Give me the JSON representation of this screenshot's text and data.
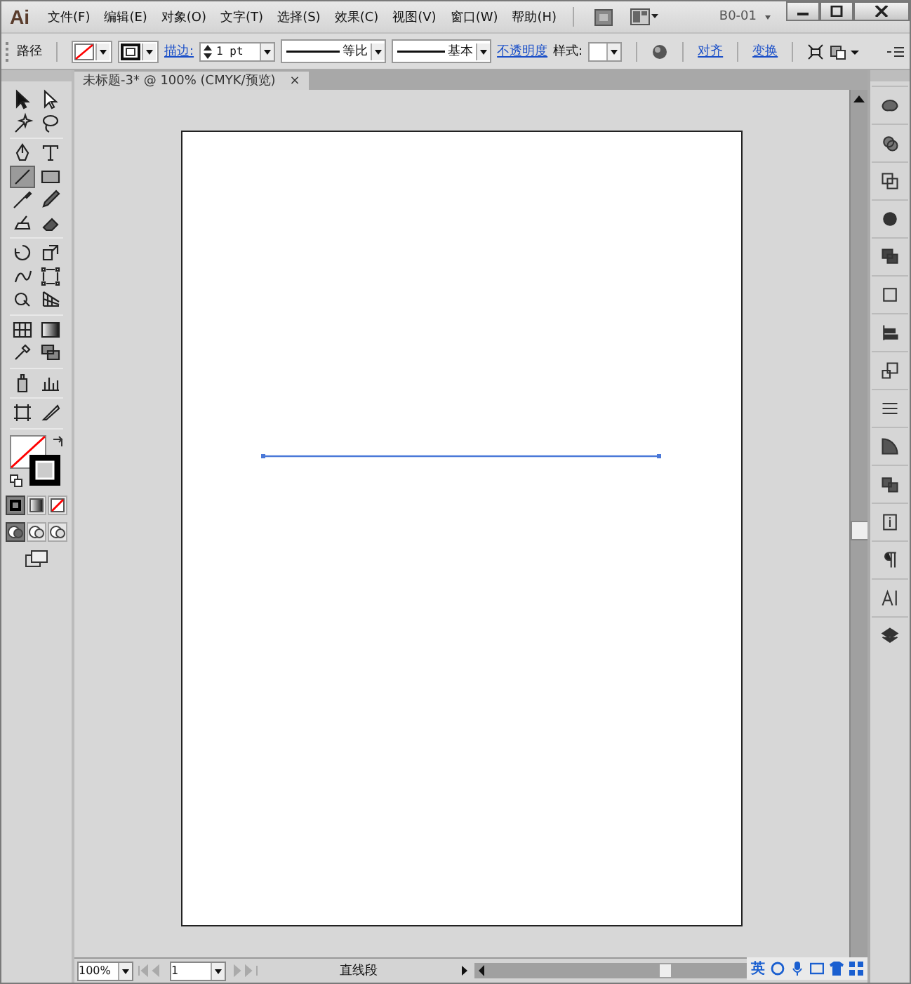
{
  "app_logo": "Ai",
  "menu": [
    "文件(F)",
    "编辑(E)",
    "对象(O)",
    "文字(T)",
    "选择(S)",
    "效果(C)",
    "视图(V)",
    "窗口(W)",
    "帮助(H)"
  ],
  "workspace": "B0-01",
  "control_bar": {
    "object_type": "路径",
    "stroke_link": "描边:",
    "stroke_weight": "1 pt",
    "profile": "等比",
    "brush": "基本",
    "opacity_link": "不透明度",
    "style_label": "样式:",
    "align_link": "对齐",
    "transform_link": "变换"
  },
  "document_tab": {
    "title": "未标题-3* @ 100% (CMYK/预览)",
    "close": "×"
  },
  "tools": [
    {
      "selected": false
    },
    {
      "selected": false
    },
    {
      "selected": false
    },
    {
      "selected": false
    },
    {
      "selected": false
    },
    {
      "selected": false
    },
    {
      "selected": true
    },
    {
      "selected": false
    },
    {
      "selected": false
    },
    {
      "selected": false
    },
    {
      "selected": false
    },
    {
      "selected": false
    },
    {
      "selected": false
    },
    {
      "selected": false
    },
    {
      "selected": false
    },
    {
      "selected": false
    },
    {
      "selected": false
    },
    {
      "selected": false
    },
    {
      "selected": false
    },
    {
      "selected": false
    },
    {
      "selected": false
    },
    {
      "selected": false
    },
    {
      "selected": false
    },
    {
      "selected": false
    },
    {
      "selected": false
    },
    {
      "selected": false
    }
  ],
  "color_modes": [
    {
      "selected": true
    },
    {
      "selected": false
    },
    {
      "selected": false
    }
  ],
  "draw_modes": [
    {
      "selected": true
    },
    {
      "selected": false
    },
    {
      "selected": false
    }
  ],
  "status_bar": {
    "zoom": "100%",
    "page": "1",
    "status": "直线段"
  },
  "ime_bar": {
    "mode": "英"
  }
}
